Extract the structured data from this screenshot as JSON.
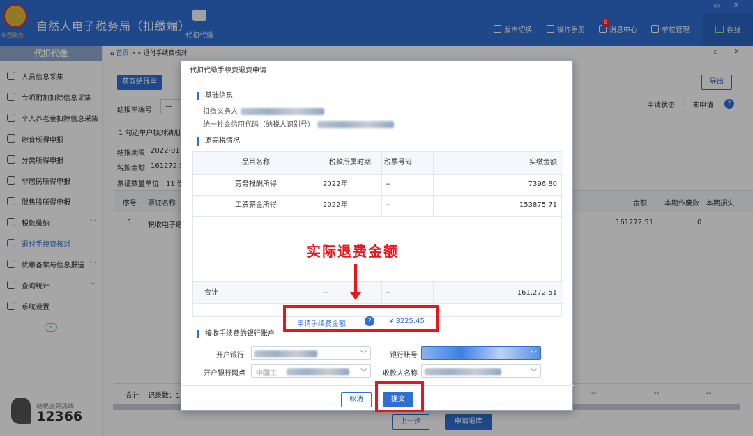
{
  "header": {
    "app_title": "自然人电子税务局（扣缴端）",
    "logo_caption": "中国税务",
    "nav_label": "代扣代缴",
    "buttons": [
      {
        "label": "版本切换",
        "icon": "doc-icon"
      },
      {
        "label": "操作手册",
        "icon": "book-icon"
      },
      {
        "label": "消息中心",
        "icon": "mail-icon"
      },
      {
        "label": "单位管理",
        "icon": "building-icon"
      }
    ],
    "message_badge": "8",
    "online_label": "在线",
    "window_controls": "– ▭ ✕"
  },
  "sidebar": {
    "title": "代扣代缴",
    "items": [
      {
        "label": "人员信息采集",
        "icon": "person-icon"
      },
      {
        "label": "专项附加扣除信息采集",
        "icon": "list-icon"
      },
      {
        "label": "个人养老金扣除信息采集",
        "icon": "card-icon"
      },
      {
        "label": "综合所得申报",
        "icon": "layers-icon"
      },
      {
        "label": "分类所得申报",
        "icon": "pie-icon"
      },
      {
        "label": "非居民所得申报",
        "icon": "person-icon"
      },
      {
        "label": "限售股所得申报",
        "icon": "bar-icon"
      },
      {
        "label": "税款缴纳",
        "icon": "wallet-icon"
      },
      {
        "label": "退付手续费核对",
        "icon": "check-doc-icon"
      },
      {
        "label": "优惠备案与信息报送",
        "icon": "doc-icon"
      },
      {
        "label": "查询统计",
        "icon": "search-icon"
      },
      {
        "label": "系统设置",
        "icon": "gear-icon"
      }
    ],
    "collapse_symbol": "«",
    "hotline_label": "纳税服务热线",
    "hotline_number": "12366"
  },
  "main": {
    "breadcrumb_home": "首页",
    "breadcrumb_sep": ">>",
    "breadcrumb_current": "退付手续费核对",
    "window_controls": "▫ ✕",
    "get_report_button": "获取结报单",
    "export_button": "导出",
    "report_no_label": "结报单编号",
    "report_no_value": "—",
    "status_label": "申请状态",
    "status_sep": "|",
    "status_value": "未申请",
    "tab_label": "1 勾选单户核对清册",
    "period_label": "结报期限",
    "period_value": "2022-01",
    "tax_amount_label": "税款金额",
    "tax_amount_value": "161272.5",
    "voucher_unit_label": "票证数量单位",
    "voucher_unit_value": "11 份",
    "table_headers": [
      "序号",
      "票证名称",
      "金额",
      "本期作废数",
      "本期损失"
    ],
    "table_rows": [
      {
        "no": "1",
        "name": "税收电子缴",
        "amount": "161272.51",
        "voided": "0"
      }
    ],
    "footer_total": "合计",
    "footer_count": "记录数：1",
    "footer_dashes": [
      "--",
      "--",
      "--"
    ],
    "prev_button": "上一步",
    "apply_refund_button": "申请退库"
  },
  "dialog": {
    "title": "代扣代缴手续费退费申请",
    "basic_info_title": "基础信息",
    "withholder_label": "扣缴义务人",
    "credit_code_label": "统一社会信用代码（纳税人识别号）",
    "tax_paid_title": "原完税情况",
    "table_headers": [
      "品目名称",
      "税款所属时期",
      "税票号码",
      "实缴金额"
    ],
    "table_rows": [
      {
        "item": "劳务报酬所得",
        "period": "2022年",
        "ticket": "--",
        "amount": "7396.80"
      },
      {
        "item": "工资薪金所得",
        "period": "2022年",
        "ticket": "--",
        "amount": "153875.71"
      }
    ],
    "total_label": "合计",
    "total_period": "--",
    "total_ticket": "--",
    "total_amount": "161,272.51",
    "fee_label": "申请手续费金额",
    "fee_value": "¥ 3225.45",
    "bank_title": "接收手续费的银行账户",
    "bank_label": "开户银行",
    "account_label": "银行账号",
    "branch_label": "开户银行网点",
    "payee_label": "收款人名称",
    "branch_value": "中国工",
    "cancel_button": "取消",
    "submit_button": "提交"
  },
  "annotation": {
    "text": "实际退费金额",
    "color": "#e8151b"
  },
  "colors": {
    "primary": "#2f6fd3",
    "header_bg": "#2f6fd3",
    "annotation_red": "#e8151b"
  }
}
